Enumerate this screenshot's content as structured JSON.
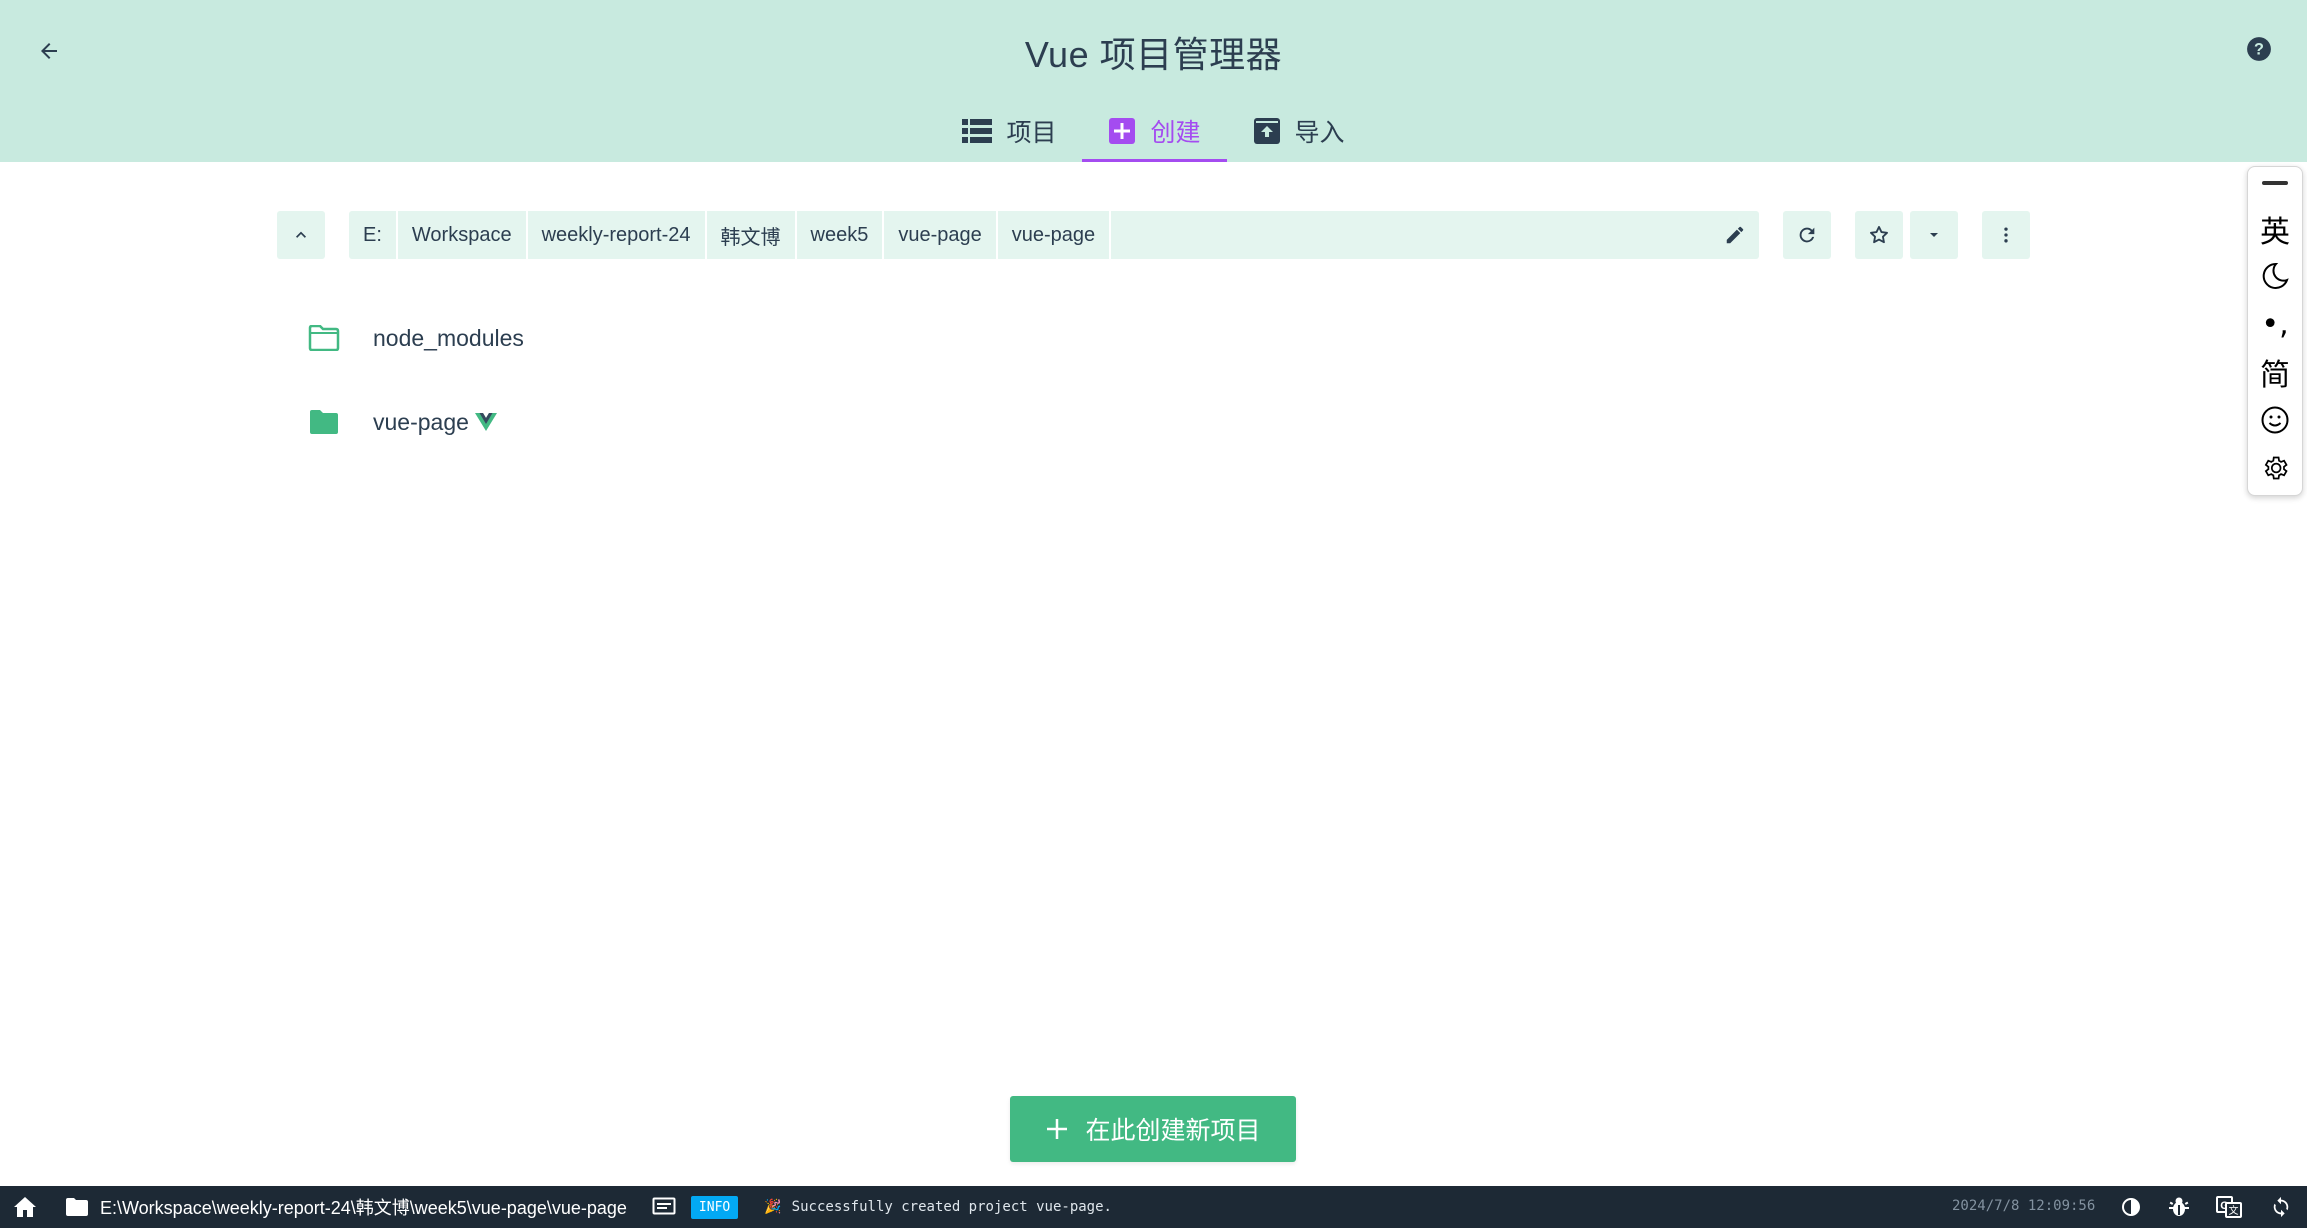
{
  "header": {
    "title": "Vue 项目管理器",
    "tabs": [
      {
        "label": "项目",
        "icon": "list-icon",
        "active": false
      },
      {
        "label": "创建",
        "icon": "add-box-icon",
        "active": true
      },
      {
        "label": "导入",
        "icon": "unarchive-icon",
        "active": false
      }
    ]
  },
  "breadcrumb": {
    "segments": [
      "E:",
      "Workspace",
      "weekly-report-24",
      "韩文博",
      "week5",
      "vue-page",
      "vue-page"
    ]
  },
  "folders": [
    {
      "name": "node_modules",
      "icon": "folder-outline-icon",
      "vue_project": false
    },
    {
      "name": "vue-page",
      "icon": "folder-icon",
      "vue_project": true
    }
  ],
  "create_button": {
    "label": "在此创建新项目",
    "icon": "plus-icon"
  },
  "ime_toolbar": {
    "lang": "英",
    "punct": "•,",
    "script": "简"
  },
  "statusbar": {
    "path": "E:\\Workspace\\weekly-report-24\\韩文博\\week5\\vue-page\\vue-page",
    "log_level": "INFO",
    "message": "Successfully created project vue-page.",
    "timestamp": "2024/7/8 12:09:56"
  },
  "colors": {
    "header_bg": "#c8eadf",
    "accent_purple": "#a44cf0",
    "primary_green": "#42b983",
    "crumb_bg": "#e4f5ef",
    "statusbar_bg": "#1d2935",
    "info_badge": "#03a9f4"
  }
}
